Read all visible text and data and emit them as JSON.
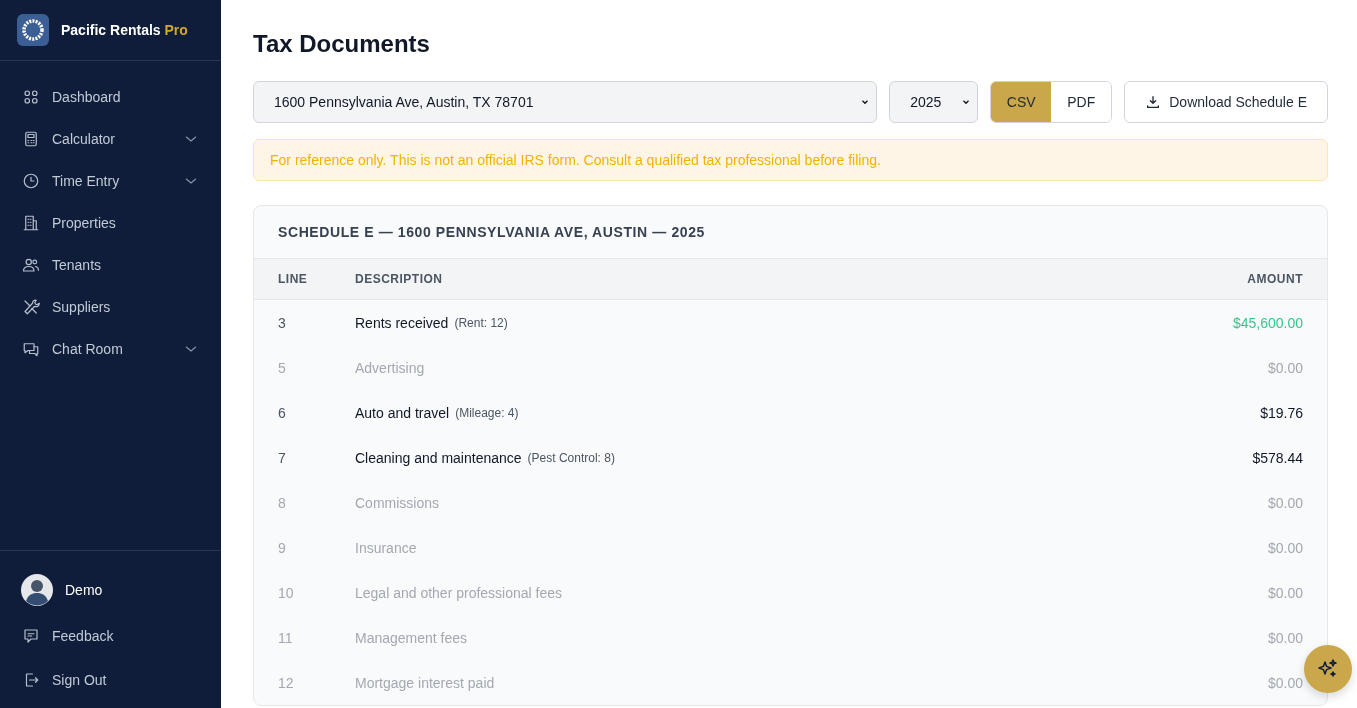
{
  "brand": {
    "name": "Pacific Rentals",
    "suffix": "Pro"
  },
  "nav": [
    {
      "label": "Dashboard",
      "expandable": false
    },
    {
      "label": "Calculator",
      "expandable": true
    },
    {
      "label": "Time Entry",
      "expandable": true
    },
    {
      "label": "Properties",
      "expandable": false
    },
    {
      "label": "Tenants",
      "expandable": false
    },
    {
      "label": "Suppliers",
      "expandable": false
    },
    {
      "label": "Chat Room",
      "expandable": true
    }
  ],
  "user": {
    "name": "Demo"
  },
  "footer_links": [
    {
      "label": "Feedback"
    },
    {
      "label": "Sign Out"
    }
  ],
  "page_title": "Tax Documents",
  "property_select": {
    "value": "1600 Pennsylvania Ave, Austin, TX 78701"
  },
  "year_select": {
    "value": "2025"
  },
  "formats": [
    {
      "label": "CSV",
      "selected": true
    },
    {
      "label": "PDF",
      "selected": false
    }
  ],
  "download_button": "Download Schedule E",
  "notice": "For reference only. This is not an official IRS form. Consult a qualified tax professional before filing.",
  "table": {
    "title": "SCHEDULE E — 1600 PENNSYLVANIA AVE, AUSTIN — 2025",
    "columns": [
      "LINE",
      "DESCRIPTION",
      "AMOUNT"
    ],
    "rows": [
      {
        "line": "3",
        "description": "Rents received",
        "note": "(Rent: 12)",
        "amount": "$45,600.00",
        "kind": "income"
      },
      {
        "line": "5",
        "description": "Advertising",
        "amount": "$0.00",
        "kind": "zero"
      },
      {
        "line": "6",
        "description": "Auto and travel",
        "note": "(Mileage: 4)",
        "amount": "$19.76",
        "kind": "expense"
      },
      {
        "line": "7",
        "description": "Cleaning and maintenance",
        "note": "(Pest Control: 8)",
        "amount": "$578.44",
        "kind": "expense"
      },
      {
        "line": "8",
        "description": "Commissions",
        "amount": "$0.00",
        "kind": "zero"
      },
      {
        "line": "9",
        "description": "Insurance",
        "amount": "$0.00",
        "kind": "zero"
      },
      {
        "line": "10",
        "description": "Legal and other professional fees",
        "amount": "$0.00",
        "kind": "zero"
      },
      {
        "line": "11",
        "description": "Management fees",
        "amount": "$0.00",
        "kind": "zero"
      },
      {
        "line": "12",
        "description": "Mortgage interest paid",
        "amount": "$0.00",
        "kind": "zero"
      }
    ]
  }
}
